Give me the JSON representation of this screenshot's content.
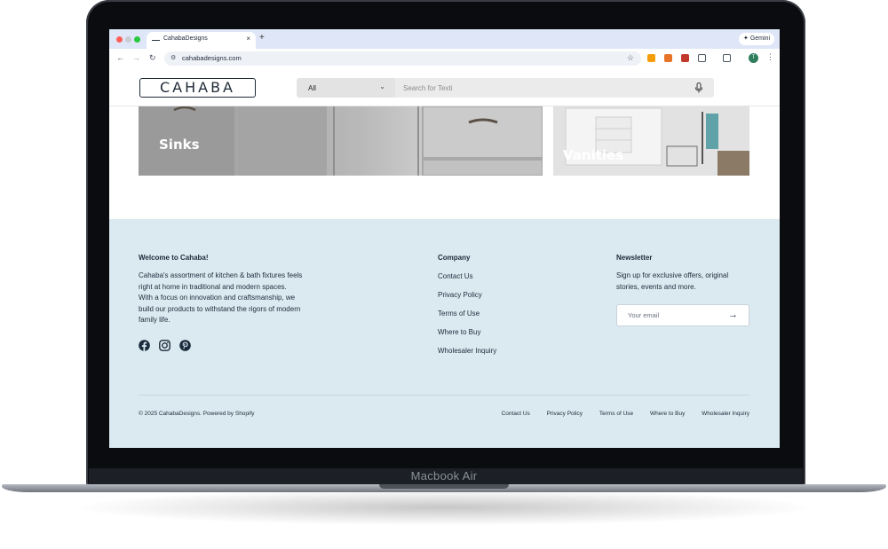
{
  "browser": {
    "tab_title": "CahabaDesigns",
    "tab_close": "×",
    "new_tab": "+",
    "gemini_label": "✦ Gemini",
    "url": "cahabadesigns.com",
    "avatar_initial": "T"
  },
  "header": {
    "logo_text": "CAHABA",
    "search_category": "All",
    "search_placeholder": "Search for Texti"
  },
  "categories": [
    {
      "label": "Sinks"
    },
    {
      "label": "Vanities"
    }
  ],
  "footer": {
    "welcome": {
      "heading": "Welcome to Cahaba!",
      "lines": [
        "Cahaba's assortment of kitchen & bath fixtures feels",
        "right at home in traditional and modern spaces.",
        "With a focus on innovation and craftsmanship, we",
        "build our products to withstand the rigors of modern",
        "family life."
      ]
    },
    "company": {
      "heading": "Company",
      "links": [
        "Contact Us",
        "Privacy Policy",
        "Terms of Use",
        "Where to Buy",
        "Wholesaler Inquiry"
      ]
    },
    "newsletter": {
      "heading": "Newsletter",
      "lines": [
        "Sign up for exclusive offers, original",
        "stories, events and more."
      ],
      "email_placeholder": "Your email",
      "submit_arrow": "→"
    },
    "copyright": "© 2025 CahabaDesigns. Powered by Shopify",
    "bottom_links": [
      "Contact Us",
      "Privacy Policy",
      "Terms of Use",
      "Where to Buy",
      "Wholesaler Inquiry"
    ]
  },
  "device": {
    "label": "Macbook Air"
  },
  "colors": {
    "footer_bg": "#dbeaf0",
    "tab_strip": "#dfe6f7",
    "text_dark": "#1b2a3a"
  }
}
